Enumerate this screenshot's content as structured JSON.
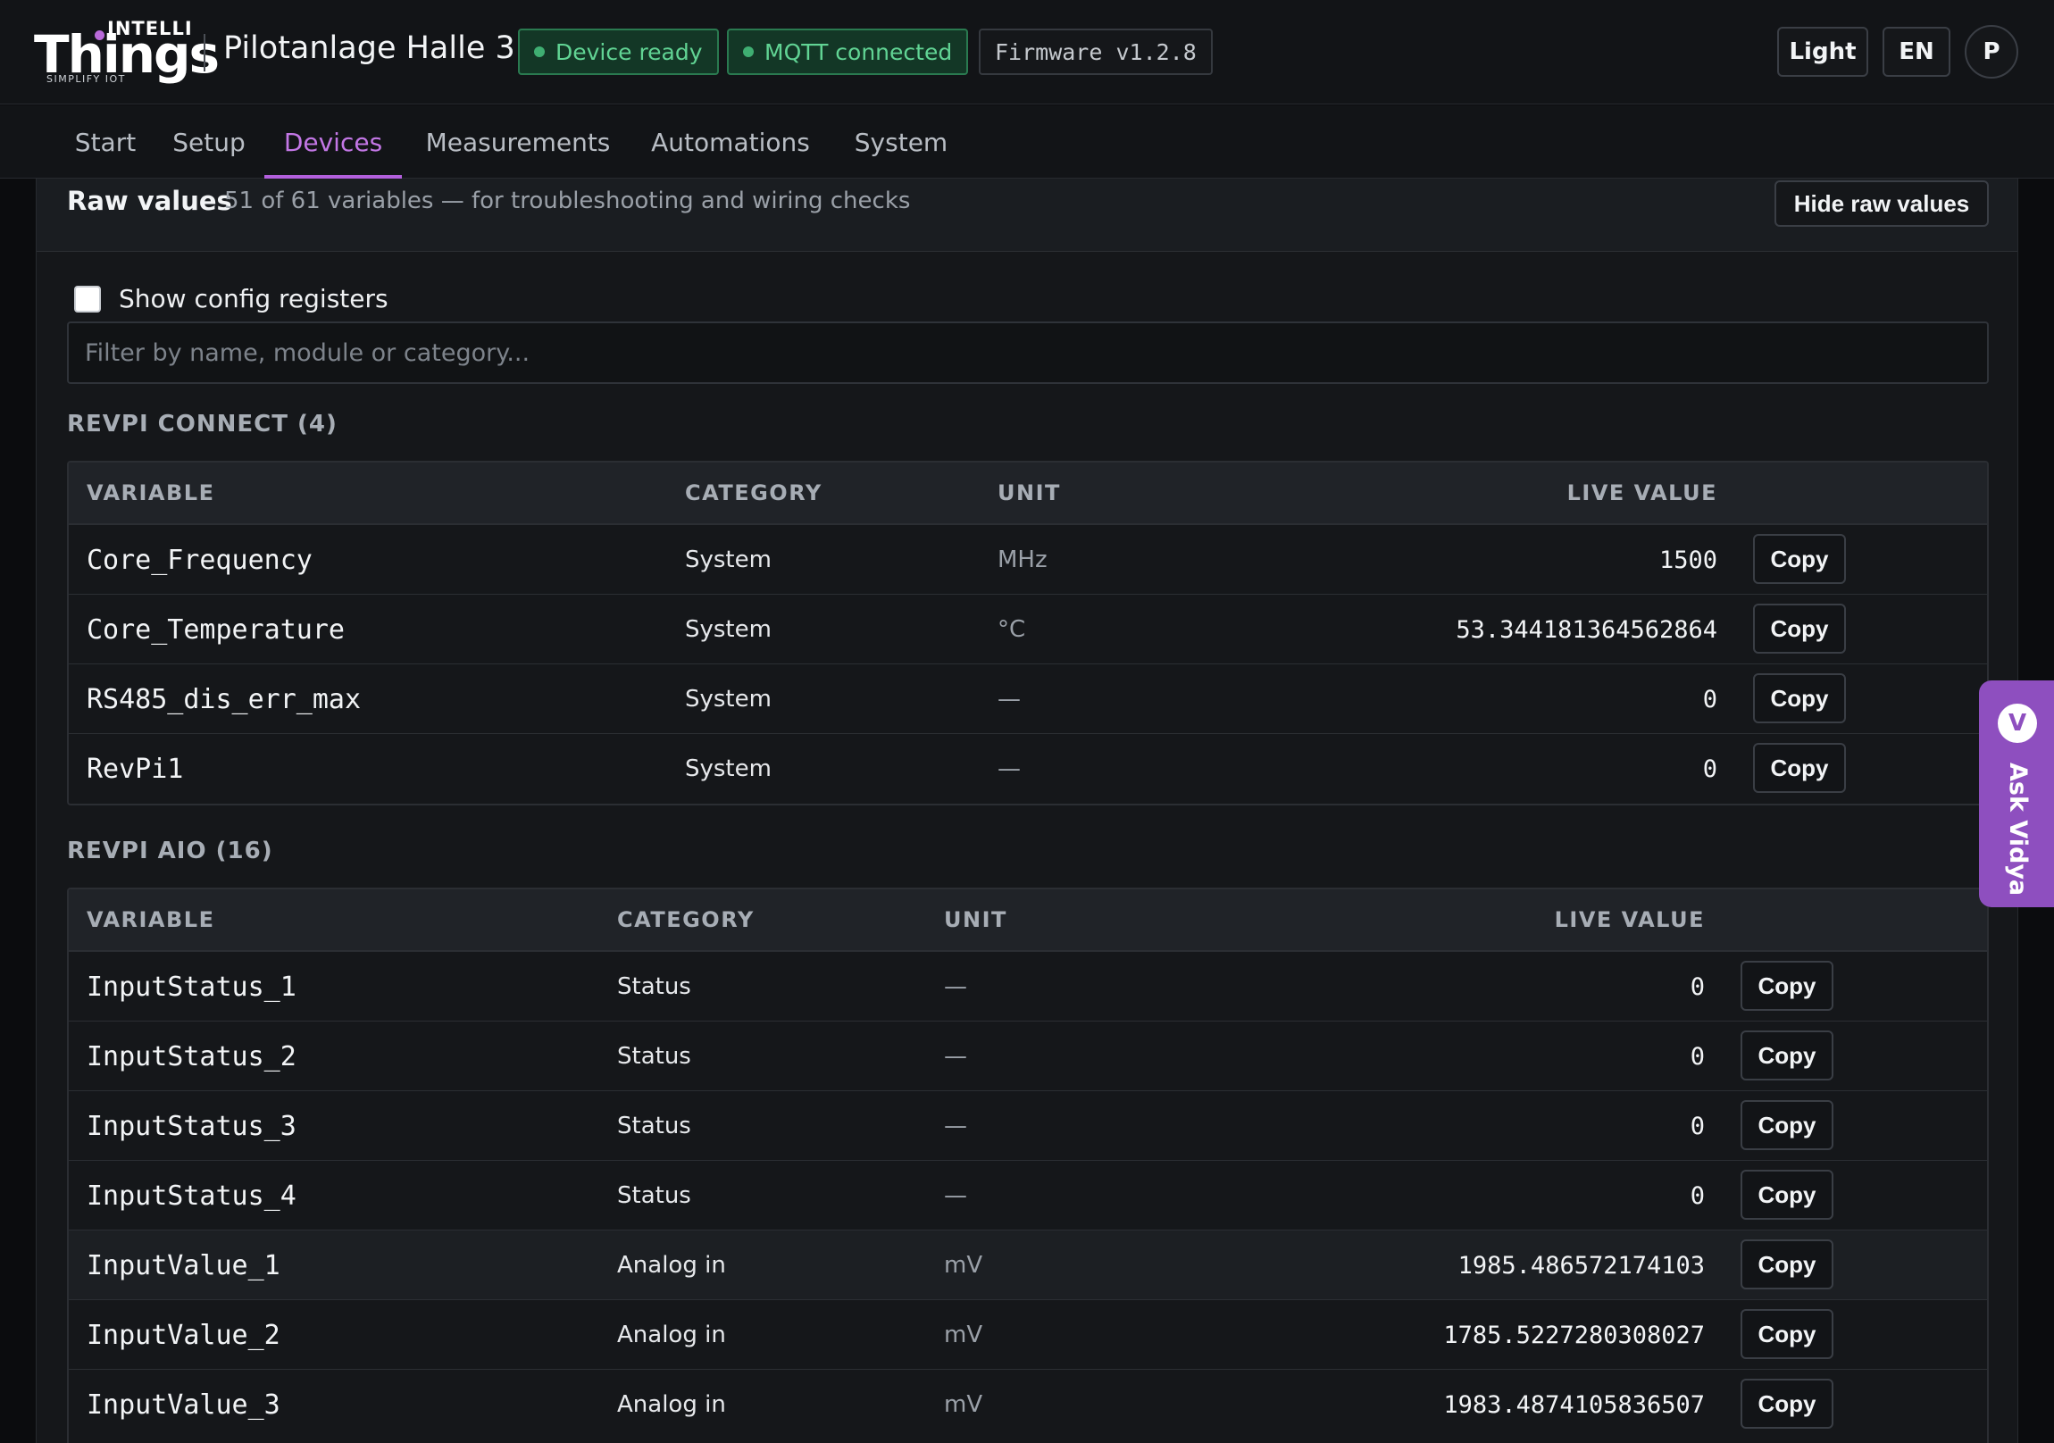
{
  "brand": {
    "top": "INTELLI",
    "main": "Things",
    "tagline": "SIMPLIFY IOT"
  },
  "header": {
    "title": "Pilotanlage Halle 3",
    "badges": {
      "device": "Device ready",
      "mqtt": "MQTT connected",
      "firmware": "Firmware v1.2.8"
    },
    "theme_button": "Light",
    "lang_button": "EN",
    "avatar_initial": "P"
  },
  "nav": {
    "tabs": [
      "Start",
      "Setup",
      "Devices",
      "Measurements",
      "Automations",
      "System"
    ],
    "active": "Devices"
  },
  "raw": {
    "title": "Raw values",
    "subtitle": "51 of 61 variables — for troubleshooting and wiring checks",
    "hide_button": "Hide raw values",
    "show_config_label": "Show config registers",
    "filter_placeholder": "Filter by name, module or category..."
  },
  "columns": {
    "variable": "VARIABLE",
    "category": "CATEGORY",
    "unit": "UNIT",
    "live_value": "LIVE VALUE"
  },
  "copy_label": "Copy",
  "sections": [
    {
      "title": "REVPI CONNECT (4)",
      "rows": [
        {
          "variable": "Core_Frequency",
          "category": "System",
          "unit": "MHz",
          "value": "1500"
        },
        {
          "variable": "Core_Temperature",
          "category": "System",
          "unit": "°C",
          "value": "53.344181364562864"
        },
        {
          "variable": "RS485_dis_err_max",
          "category": "System",
          "unit": "—",
          "value": "0"
        },
        {
          "variable": "RevPi1",
          "category": "System",
          "unit": "—",
          "value": "0"
        }
      ]
    },
    {
      "title": "REVPI AIO (16)",
      "rows": [
        {
          "variable": "InputStatus_1",
          "category": "Status",
          "unit": "—",
          "value": "0"
        },
        {
          "variable": "InputStatus_2",
          "category": "Status",
          "unit": "—",
          "value": "0"
        },
        {
          "variable": "InputStatus_3",
          "category": "Status",
          "unit": "—",
          "value": "0"
        },
        {
          "variable": "InputStatus_4",
          "category": "Status",
          "unit": "—",
          "value": "0"
        },
        {
          "variable": "InputValue_1",
          "category": "Analog in",
          "unit": "mV",
          "value": "1985.486572174103"
        },
        {
          "variable": "InputValue_2",
          "category": "Analog in",
          "unit": "mV",
          "value": "1785.5227280308027"
        },
        {
          "variable": "InputValue_3",
          "category": "Analog in",
          "unit": "mV",
          "value": "1983.4874105836507"
        }
      ]
    }
  ],
  "assistant": {
    "initial": "V",
    "label": "Ask Vidya"
  },
  "colors": {
    "accent": "#b25fdc",
    "ok": "#61d494",
    "background": "#0b0c0e"
  }
}
